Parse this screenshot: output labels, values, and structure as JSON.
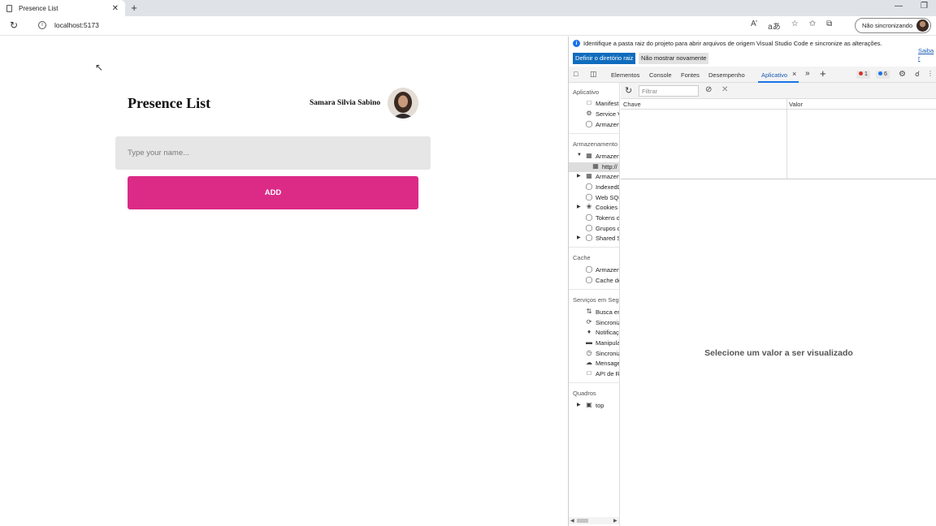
{
  "browser": {
    "tab_title": "Presence List",
    "tab_close": "✕",
    "new_tab": "+",
    "url": "localhost:5173",
    "sync_label": "Não sincronizando",
    "reload_glyph": "↻",
    "info_glyph": "i",
    "window_minimize": "—",
    "window_restore": "❐",
    "toolbar_icons": [
      "A’",
      "aあ",
      "☆",
      "✩",
      "⧉"
    ]
  },
  "app": {
    "title": "Presence List",
    "user_name": "Samara Silvia Sabino",
    "input_placeholder": "Type your name...",
    "input_value": "",
    "add_label": "ADD",
    "accent_color": "#db2b87"
  },
  "devtools": {
    "banner_message": "Identifique a pasta raiz do projeto para abrir arquivos de origem Visual Studio Code e sincronize as alterações.",
    "banner_more": "Saiba r",
    "banner_primary": "Definir o diretório raiz",
    "banner_secondary": "Não mostrar novamente",
    "tabs": {
      "elements": "Elementos",
      "console": "Console",
      "sources": "Fontes",
      "performance": "Desempenho",
      "application": "Aplicativo",
      "close": "×",
      "more": "»",
      "add": "+"
    },
    "errors_count": "1",
    "info_count": "6",
    "sidebar": {
      "sections": {
        "application": "Aplicativo",
        "storage": "Armazenamento",
        "cache": "Cache",
        "background": "Serviços em Segu",
        "frames": "Quadros"
      },
      "application_items": [
        "Manifest",
        "Service V",
        "Armazen"
      ],
      "storage_items": [
        "Armazen",
        "http://",
        "Armazen",
        "IndexedD",
        "Web SQL",
        "Cookies",
        "Tokens d",
        "Grupos c",
        "Shared S"
      ],
      "cache_items": [
        "Armazen",
        "Cache de"
      ],
      "background_items": [
        "Busca en",
        "Sincroniz",
        "Notificaç",
        "Manipula",
        "Sincroniz",
        "Mensage",
        "API de R"
      ],
      "frames_items": [
        "top"
      ]
    },
    "filter_placeholder": "Filtrar",
    "columns": {
      "key": "Chave",
      "value": "Valor"
    },
    "empty_message": "Selecione um valor a ser visualizado"
  }
}
